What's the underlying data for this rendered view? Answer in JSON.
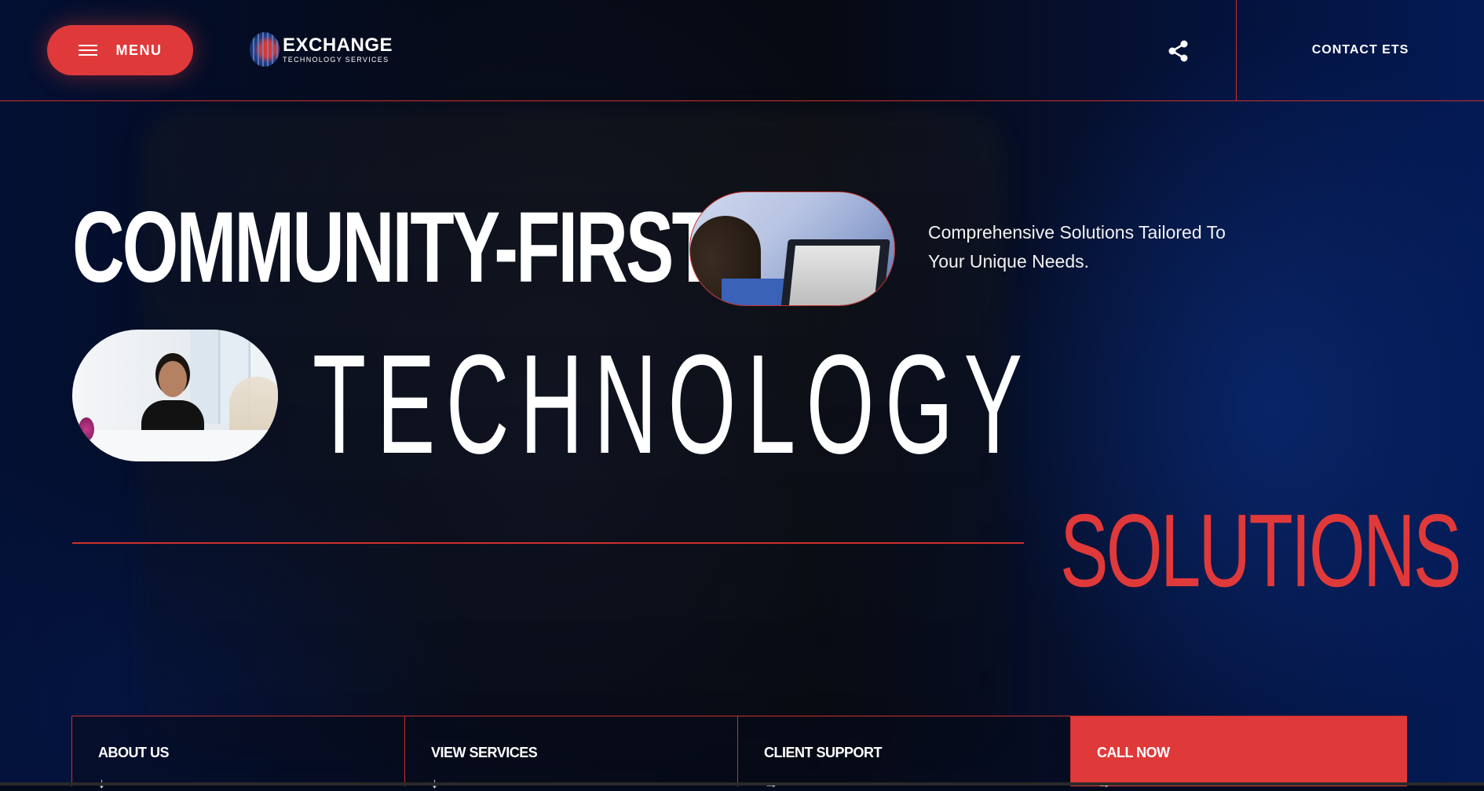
{
  "header": {
    "menu_label": "MENU",
    "logo_main": "EXCHANGE",
    "logo_sub": "TECHNOLOGY SERVICES",
    "contact_label": "CONTACT ETS",
    "share_icon": "share-icon"
  },
  "hero": {
    "line1": "COMMUNITY-FIRST",
    "line2": "TECHNOLOGY",
    "line3": "SOLUTIONS",
    "tagline": "Comprehensive Solutions Tailored To Your Unique Needs."
  },
  "nav": {
    "items": [
      {
        "label": "ABOUT US",
        "icon": "arrow-down-icon"
      },
      {
        "label": "VIEW SERVICES",
        "icon": "arrow-down-icon"
      },
      {
        "label": "CLIENT SUPPORT",
        "icon": "arrow-right-icon"
      },
      {
        "label": "CALL NOW",
        "icon": "arrow-right-icon"
      }
    ]
  },
  "colors": {
    "accent": "#e0393a",
    "background": "#050b1f",
    "text": "#ffffff"
  }
}
